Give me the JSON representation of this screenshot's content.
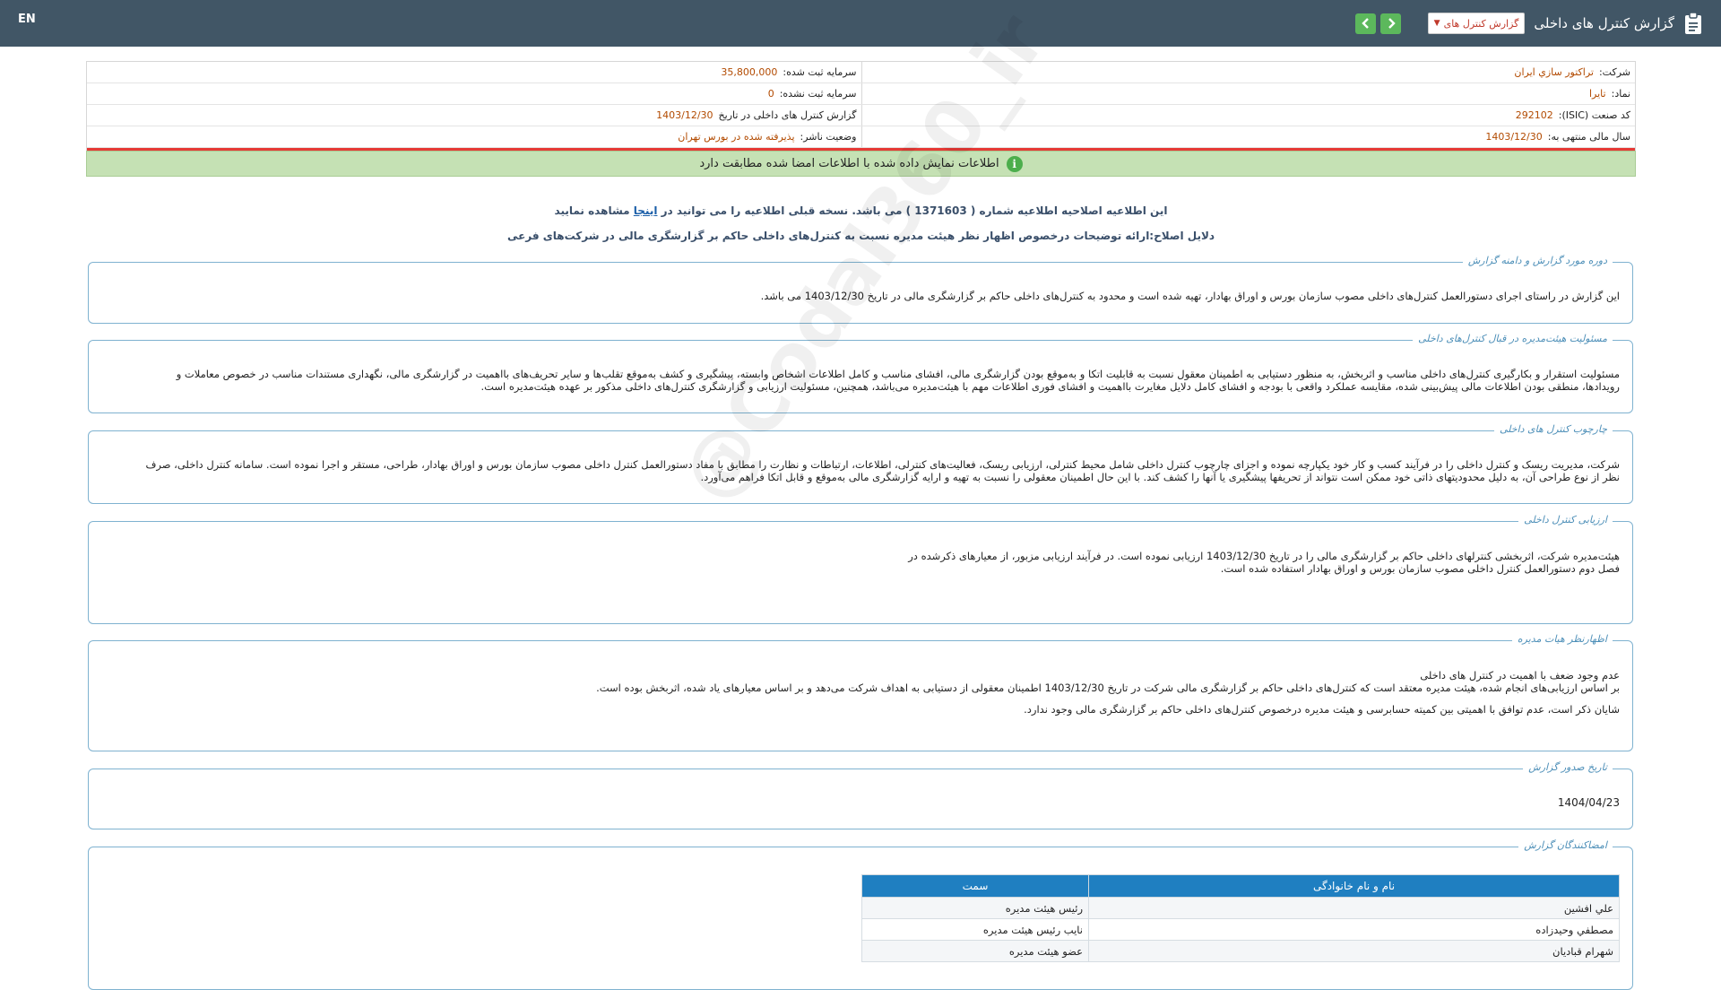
{
  "topbar": {
    "lang": "EN",
    "title": "گزارش کنترل های داخلی",
    "report_select": "گزارش کنترل های",
    "prev_label": "‹",
    "next_label": "›"
  },
  "info": {
    "company_label": "شرکت:",
    "company_value": "تراكتور سازي ايران",
    "capital_label": "سرمایه ثبت شده:",
    "capital_value": "35,800,000",
    "symbol_label": "نماد:",
    "symbol_value": "تايرا",
    "unreg_capital_label": "سرمایه ثبت نشده:",
    "unreg_capital_value": "0",
    "isic_label": "کد صنعت (ISIC):",
    "isic_value": "292102",
    "report_date_label": "گزارش کنترل های داخلی در تاریخ",
    "report_date_value": "1403/12/30",
    "fy_label": "سال مالی منتهی به:",
    "fy_value": "1403/12/30",
    "status_label": "وضعیت ناشر:",
    "status_value": "پذیرفته شده در بورس تهران"
  },
  "notice": "اطلاعات نمایش داده شده با اطلاعات امضا شده مطابقت دارد",
  "headline1_a": "این اطلاعیه اصلاحیه اطلاعیه شماره ( 1371603 ) می باشد. نسخه قبلی اطلاعیه را می توانید در",
  "headline1_link": "اینجا",
  "headline1_b": "مشاهده نمایید",
  "headline2": "دلایل اصلاح:ارائه توضیحات درخصوص اظهار نظر هیئت مدیره نسبت به کنترل‌های داخلی حاکم بر گزارشگری مالی در شرکت‌های فرعی",
  "sections": {
    "scope": {
      "title": "دوره مورد گزارش و دامنه گزارش",
      "text": "این گزارش در راستای اجرای دستورالعمل کنترل‌های داخلی مصوب سازمان بورس و اوراق بهادار، تهیه شده است و محدود به کنترل‌های داخلی حاکم بر گزارشگری مالی در تاریخ 1403/12/30 می باشد."
    },
    "responsibility": {
      "title": "مسئولیت هیئت‌مدیره در قبال کنترل‌های داخلی",
      "text1": "مسئولیت استقرار و بکارگیری کنترل‌های داخلی مناسب و اثربخش، به منظور دستیابی به اطمینان معقول نسبت به قابلیت اتکا و به‌موقع بودن گزارشگری مالی، افشای مناسب و کامل اطلاعات اشخاص وابسته، پیشگیری و کشف به‌موقع تقلب‌ها و سایر تحریف‌های بااهمیت در گزارشگری مالی، نگهداری مستندات مناسب در خصوص معاملات و",
      "text2": "رویدادها، منطقی بودن اطلاعات مالی پیش‌بینی شده، مقایسه عملکرد واقعی با بودجه و افشای کامل دلایل مغایرت بااهمیت و افشای فوری اطلاعات مهم با هیئت‌مدیره می‌باشد، همچنین، مسئولیت ارزیابی و گزارشگری کنترل‌های داخلی مذکور بر عهده هیئت‌مدیره است."
    },
    "framework": {
      "title": "چارچوب کنترل های داخلی",
      "text1": "شرکت، مدیریت ریسک و کنترل داخلی را در فرآیند کسب و کار خود یکپارچه نموده و اجزای چارچوب کنترل داخلی شامل محیط کنترلی، ارزیابی ریسک، فعالیت‌های کنترلی، اطلاعات، ارتباطات و نظارت را مطابق با مفاد دستورالعمل کنترل داخلی مصوب سازمان بورس و اوراق بهادار، طراحی، مستقر و اجرا نموده است. سامانه کنترل داخلی، صرف",
      "text2": "نظر از نوع طراحی آن، به دلیل محدودیتهای ذاتی خود ممکن است نتواند از تحریفها پیشگیری یا آنها را کشف کند. با این حال اطمینان معقولی را نسبت به تهیه و ارایه گزارشگری مالی به‌موقع و قابل اتکا فراهم می‌آورد."
    },
    "evaluation": {
      "title": "ارزیابی کنترل داخلی",
      "text1": "هیئت‌مدیره شرکت، اثربخشی کنترلهای داخلی حاکم بر گزارشگری مالی را در تاریخ 1403/12/30 ارزیابی نموده است. در فرآیند ارزیابی مزبور، از معیارهای ذکرشده در",
      "text2": "فصل دوم دستورالعمل کنترل داخلی مصوب سازمان بورس و اوراق بهادار استفاده شده است."
    },
    "opinion": {
      "title": "اظهارنظر هیات مدیره",
      "text1": "عدم وجود ضعف با اهمیت در کنترل های داخلی",
      "text2": "بر اساس ارزیابی‌های انجام شده، هیئت مدیره معتقد است که کنترل‌های داخلی حاکم بر گزارشگری مالی شرکت در تاریخ 1403/12/30 اطمینان معقولی از دستیابی به اهداف شرکت می‌دهد و بر اساس معیارهای یاد شده، اثربخش بوده است.",
      "text3": "شایان ذکر است، عدم توافق با اهمیتی بین کمیته حسابرسی و هیئت مدیره درخصوص کنترل‌های داخلی حاکم بر گزارشگری مالی وجود ندارد."
    },
    "issue_date": {
      "title": "تاریخ صدور گزارش",
      "text": "1404/04/23"
    },
    "signatories": {
      "title": "امضاکنندگان گزارش",
      "headers": [
        "نام و نام خانوادگی",
        "سمت"
      ],
      "rows": [
        [
          "علي افشين",
          "رئيس هيئت مديره"
        ],
        [
          "مصطفي وحيدزاده",
          "نايب رئيس هيئت مديره"
        ],
        [
          "شهرام قباديان",
          "عضو هيئت مديره"
        ]
      ]
    }
  },
  "watermark": "@Codal360_ir"
}
